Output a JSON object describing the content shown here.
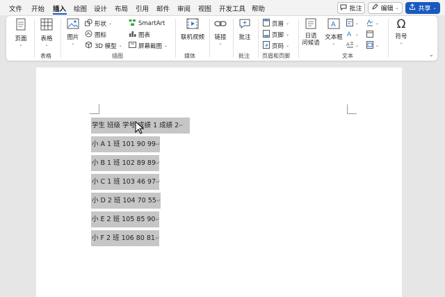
{
  "menu": [
    "文件",
    "开始",
    "插入",
    "绘图",
    "设计",
    "布局",
    "引用",
    "邮件",
    "审阅",
    "视图",
    "开发工具",
    "帮助"
  ],
  "menu_active_index": 2,
  "right_buttons": {
    "comment": "批注",
    "edit": "编辑",
    "share": "共享"
  },
  "ribbon": {
    "pages": "页面",
    "table": "表格",
    "table_group": "表格",
    "picture": "图片",
    "shapes": "形状",
    "icons": "图标",
    "model3d": "3D 模型",
    "smartart": "SmartArt",
    "chart": "图表",
    "screenshot": "屏幕截图",
    "illustrations_group": "插图",
    "online_video": "联机视频",
    "media_group": "媒体",
    "link": "链接",
    "comment": "批注",
    "comment_group": "批注",
    "header": "页眉",
    "footer": "页脚",
    "page_number": "页码",
    "header_footer_group": "页眉和页脚",
    "japanese_greeting": "日语\n问候语",
    "textbox": "文本框",
    "text_group": "文本",
    "symbol": "符号"
  },
  "document": {
    "lines": [
      "学生 班级 学号 成绩 1 成绩 2",
      "小 A 1 班 101 90 99",
      "小 B 1 班 102 89 89",
      "小 C 1 班 103 46 97",
      "小 D 2 班 104 70 55",
      "小 E 2 班 105 85 90",
      "小 F 2 班 106 80 81"
    ],
    "para_mark": "↵"
  },
  "colors": {
    "accent": "#185abd",
    "selection": "#c6c6c6",
    "ribbon_bg": "#ffffff",
    "canvas": "#e6e6e6"
  }
}
